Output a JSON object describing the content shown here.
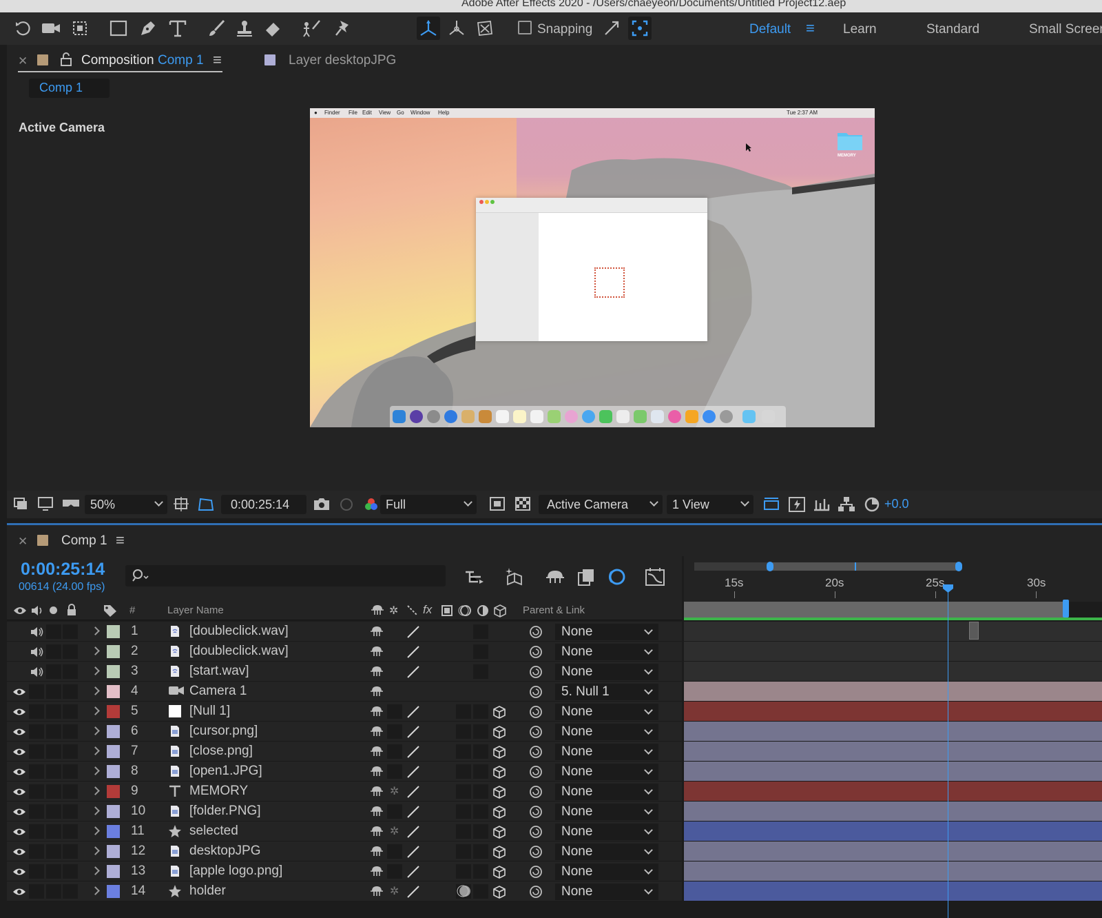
{
  "window": {
    "title": "Adobe After Effects 2020 - /Users/chaeyeon/Documents/Untitled Project12.aep"
  },
  "toolbar": {
    "snapping_label": "Snapping",
    "workspaces": [
      "Default",
      "Learn",
      "Standard",
      "Small Screen"
    ],
    "active_workspace": "Default"
  },
  "comp_panel": {
    "tab_prefix": "Composition",
    "tab_comp": "Comp 1",
    "layer_tab": "Layer desktopJPG",
    "subtab": "Comp 1",
    "viewer_label": "Active Camera"
  },
  "preview": {
    "menubar": [
      "Finder",
      "File",
      "Edit",
      "View",
      "Go",
      "Window",
      "Help"
    ],
    "clock": "Tue 2:37 AM",
    "folder_caption": "MEMORY"
  },
  "viewer_bar": {
    "zoom": "50%",
    "time": "0:00:25:14",
    "resolution": "Full",
    "camera": "Active Camera",
    "views": "1 View",
    "exposure": "+0.0"
  },
  "timeline": {
    "tab": "Comp 1",
    "timecode": "0:00:25:14",
    "frames": "00614 (24.00 fps)",
    "col_hash": "#",
    "col_layer_name": "Layer Name",
    "col_parent": "Parent & Link",
    "ruler": [
      "15s",
      "20s",
      "25s",
      "30s"
    ],
    "playhead_seconds": 25.58,
    "layers": [
      {
        "num": "1",
        "name": "[doubleclick.wav]",
        "type": "audio",
        "label": "#b9cbb5",
        "parent": "None"
      },
      {
        "num": "2",
        "name": "[doubleclick.wav]",
        "type": "audio",
        "label": "#b9cbb5",
        "parent": "None"
      },
      {
        "num": "3",
        "name": "[start.wav]",
        "type": "audio",
        "label": "#b9cbb5",
        "parent": "None"
      },
      {
        "num": "4",
        "name": "Camera 1",
        "type": "camera",
        "label": "#e4bfc8",
        "parent": "5. Null 1"
      },
      {
        "num": "5",
        "name": "[Null 1]",
        "type": "null",
        "label": "#b33b39",
        "parent": "None"
      },
      {
        "num": "6",
        "name": "[cursor.png]",
        "type": "image",
        "label": "#aeaed6",
        "parent": "None"
      },
      {
        "num": "7",
        "name": "[close.png]",
        "type": "image",
        "label": "#aeaed6",
        "parent": "None"
      },
      {
        "num": "8",
        "name": "[open1.JPG]",
        "type": "image",
        "label": "#aeaed6",
        "parent": "None"
      },
      {
        "num": "9",
        "name": "MEMORY",
        "type": "text",
        "label": "#b33b39",
        "parent": "None"
      },
      {
        "num": "10",
        "name": "[folder.PNG]",
        "type": "image",
        "label": "#aeaed6",
        "parent": "None"
      },
      {
        "num": "11",
        "name": "selected",
        "type": "shape",
        "label": "#6b7fe0",
        "parent": "None"
      },
      {
        "num": "12",
        "name": "desktopJPG",
        "type": "image",
        "label": "#aeaed6",
        "parent": "None"
      },
      {
        "num": "13",
        "name": "[apple logo.png]",
        "type": "image",
        "label": "#aeaed6",
        "parent": "None"
      },
      {
        "num": "14",
        "name": "holder",
        "type": "shape",
        "label": "#6b7fe0",
        "parent": "None"
      }
    ]
  },
  "colors": {
    "accent": "#3d9bf2",
    "work_area_green": "#3cb54a"
  }
}
